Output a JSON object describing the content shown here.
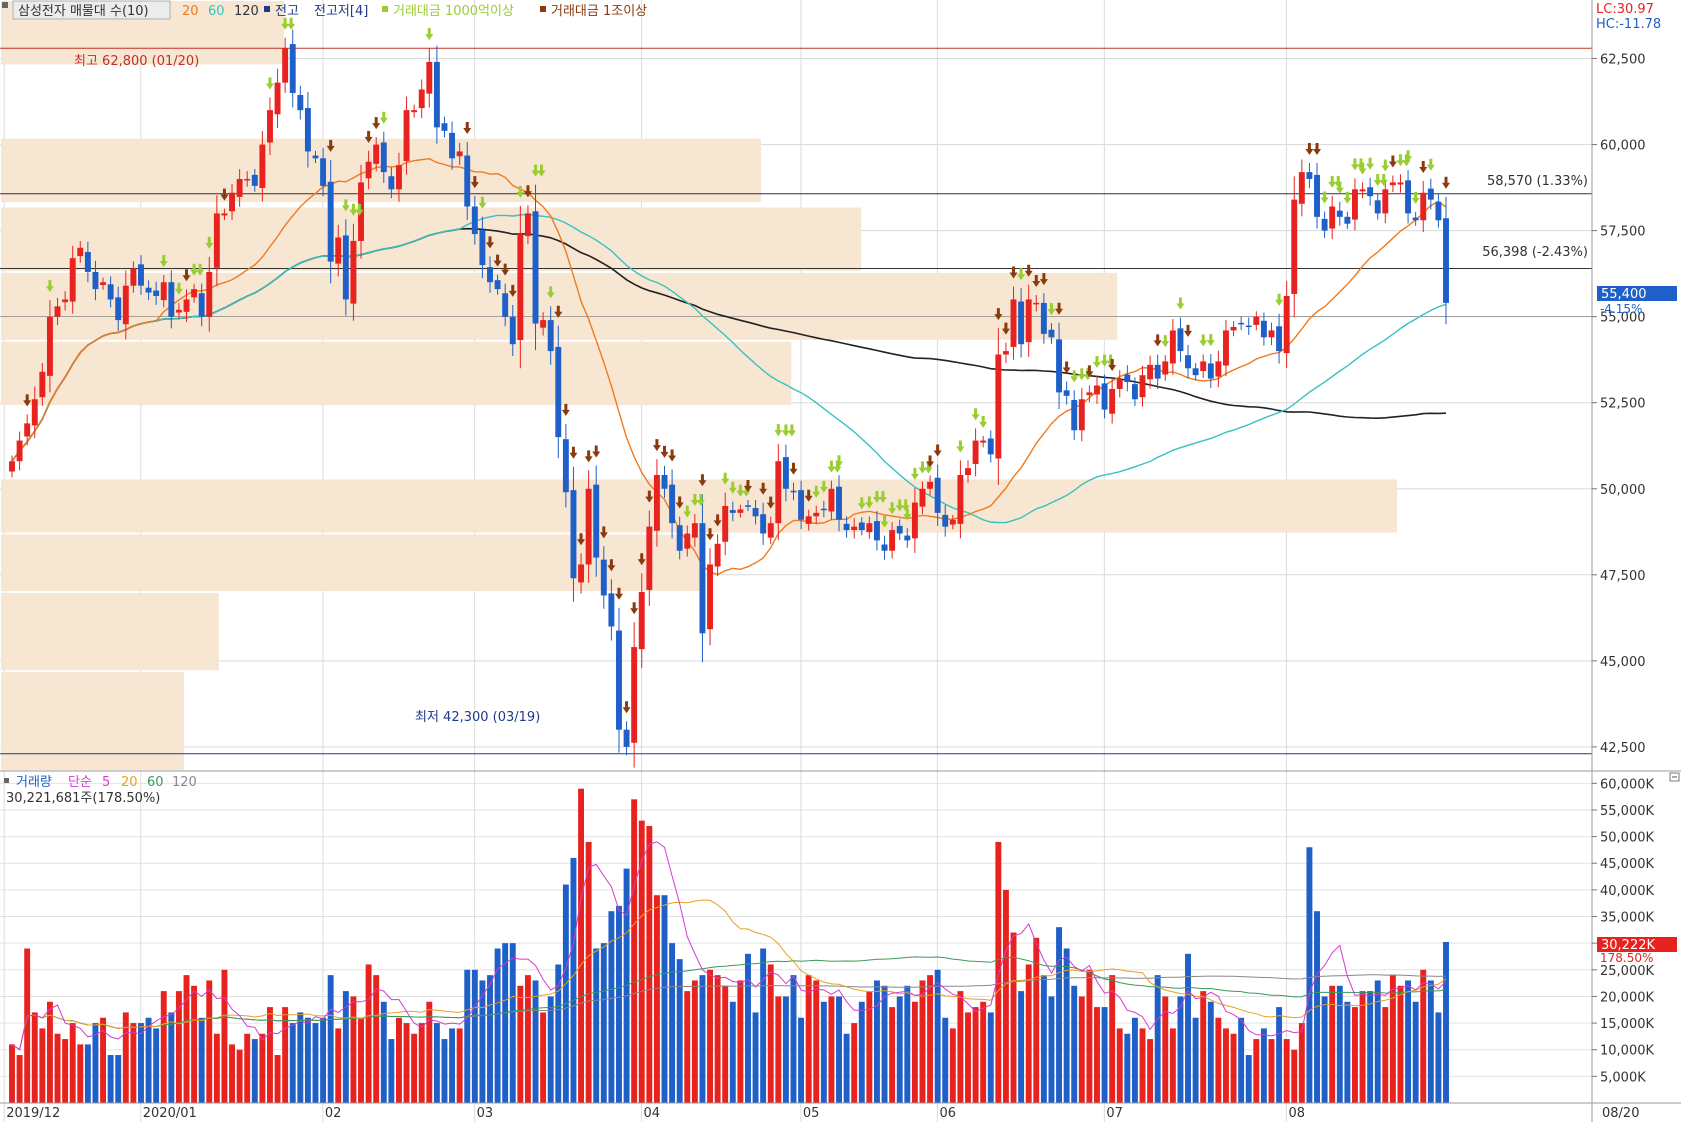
{
  "header": {
    "title": "삼성전자 매물대 수(10)",
    "ma_periods": [
      "20",
      "60",
      "120"
    ],
    "prev_high": "전고",
    "prev_high_low": "전고저[4]",
    "value_1000": "거래대금 1000억이상",
    "value_1t": "거래대금 1조이상",
    "lc": "LC:30.97",
    "hc": "HC:-11.78"
  },
  "volume_header": {
    "title": "거래량",
    "simple": "단순",
    "periods": [
      "5",
      "20",
      "60",
      "120"
    ],
    "current": "30,221,681주(178.50%)"
  },
  "annotations": {
    "high": "최고 62,800 (01/20)",
    "low": "최저 42,300 (03/19)",
    "level1": "58,570 (1.33%)",
    "level2": "56,398 (-2.43%)",
    "last_price": "55,400",
    "last_change": "-4.15%",
    "last_volume": "30,222K",
    "last_volume_pct": "178.50%"
  },
  "x_axis": {
    "labels": [
      "2019/12",
      "2020/01",
      "02",
      "03",
      "04",
      "05",
      "06",
      "07",
      "08"
    ],
    "right_label": "08/20"
  },
  "colors": {
    "up": "#e8231f",
    "down": "#1f5fc8",
    "ma20": "#f07a1e",
    "ma60": "#38c2c0",
    "ma120": "#222222",
    "profile": "#f7e6d2",
    "arrow_brown": "#8b3a0e",
    "arrow_green": "#9acd32",
    "vol_ma5": "#d43ad0",
    "vol_ma20": "#e8a020",
    "vol_ma60": "#3a9a5a",
    "vol_ma120": "#888888"
  },
  "chart_data": {
    "type": "candlestick",
    "price_ticks": [
      "62,500",
      "60,000",
      "57,500",
      "55,000",
      "52,500",
      "50,000",
      "47,500",
      "45,000",
      "42,500"
    ],
    "volume_ticks": [
      "60,000K",
      "55,000K",
      "50,000K",
      "45,000K",
      "40,000K",
      "35,000K",
      "30,000K",
      "25,000K",
      "20,000K",
      "15,000K",
      "10,000K",
      "5,000K"
    ],
    "ylim_price": [
      41800,
      64200
    ],
    "ylim_volume": [
      0,
      61000
    ],
    "hlines": [
      62800,
      58570,
      56398,
      42300
    ],
    "closes": [
      50800,
      51400,
      51900,
      52600,
      53400,
      55000,
      55300,
      55500,
      56700,
      57000,
      56300,
      55800,
      56000,
      55500,
      54900,
      55900,
      56400,
      55900,
      55700,
      55600,
      56000,
      55000,
      55200,
      55500,
      55800,
      55000,
      56300,
      58000,
      58000,
      58600,
      59000,
      59000,
      58800,
      60000,
      61000,
      61800,
      62800,
      61500,
      61000,
      59800,
      59600,
      58800,
      56600,
      57300,
      55500,
      57200,
      58900,
      59500,
      60000,
      59200,
      58700,
      59400,
      61000,
      61000,
      61600,
      62400,
      60500,
      60400,
      59600,
      59800,
      58200,
      57400,
      56500,
      56000,
      55800,
      55000,
      54200,
      57400,
      58000,
      54800,
      54900,
      54000,
      51500,
      49900,
      47400,
      47800,
      50000,
      48000,
      46900,
      46000,
      43000,
      42500,
      45400,
      47000,
      48900,
      50400,
      50000,
      49000,
      48200,
      48700,
      49000,
      45800,
      47800,
      48400,
      49500,
      49300,
      49400,
      49500,
      49200,
      48700,
      49000,
      50800,
      50000,
      49900,
      49100,
      49200,
      49300,
      49400,
      50000,
      49100,
      48800,
      48900,
      48800,
      49000,
      48500,
      48200,
      48800,
      48700,
      48500,
      49600,
      50000,
      50200,
      49300,
      48900,
      49100,
      50400,
      50600,
      51400,
      51400,
      51000,
      53900,
      54000,
      55500,
      54200,
      55500,
      55400,
      54500,
      54400,
      52800,
      52700,
      51700,
      52600,
      52800,
      53000,
      52300,
      52900,
      53200,
      53100,
      52600,
      53300,
      53600,
      53200,
      53700,
      54600,
      54000,
      53500,
      53300,
      53700,
      53200,
      53700,
      54600,
      54700,
      54800,
      54700,
      55000,
      54400,
      54600,
      54000,
      55600,
      58400,
      59200,
      59000,
      57900,
      57500,
      58200,
      57900,
      57700,
      58700,
      58700,
      58500,
      58000,
      58700,
      58900,
      58900,
      58000,
      57800,
      58600,
      58400,
      57800,
      55400
    ],
    "volumes": [
      11000,
      9000,
      29000,
      17000,
      14000,
      19000,
      13000,
      12000,
      15000,
      11000,
      11000,
      15000,
      16000,
      9000,
      9000,
      17000,
      15000,
      15000,
      16000,
      14000,
      21000,
      17000,
      21000,
      24000,
      22000,
      16000,
      23000,
      13000,
      25000,
      11000,
      10000,
      13000,
      12000,
      13000,
      18000,
      9000,
      18000,
      15000,
      17000,
      16000,
      15000,
      16000,
      24000,
      14000,
      21000,
      20000,
      16000,
      26000,
      24000,
      19000,
      12000,
      16000,
      15000,
      13000,
      15000,
      19000,
      15000,
      12000,
      14000,
      14000,
      25000,
      25000,
      23000,
      24000,
      29000,
      30000,
      30000,
      22000,
      24000,
      23000,
      17000,
      20000,
      26000,
      41000,
      46000,
      59000,
      49000,
      29000,
      30000,
      36000,
      37000,
      44000,
      57000,
      53000,
      52000,
      39000,
      39000,
      30000,
      27000,
      21000,
      23000,
      24000,
      25000,
      24000,
      22000,
      19000,
      23000,
      28000,
      17000,
      29000,
      26000,
      20000,
      20000,
      24000,
      16000,
      24000,
      23000,
      19000,
      20000,
      20000,
      13000,
      15000,
      19000,
      21000,
      23000,
      22000,
      18000,
      20000,
      22000,
      19000,
      23000,
      24000,
      25000,
      16000,
      14000,
      21000,
      17000,
      18000,
      19000,
      17000,
      49000,
      40000,
      32000,
      21000,
      26000,
      31000,
      24000,
      20000,
      33000,
      29000,
      22000,
      20000,
      25000,
      18000,
      18000,
      24000,
      14000,
      13000,
      16000,
      14000,
      12000,
      24000,
      20000,
      14000,
      20000,
      28000,
      16000,
      21000,
      19000,
      16000,
      14000,
      13000,
      16000,
      9000,
      12000,
      14000,
      12000,
      18000,
      12000,
      10000,
      15000,
      48000,
      36000,
      20000,
      22000,
      22000,
      19000,
      18000,
      21000,
      21000,
      23000,
      18000,
      24000,
      22000,
      23000,
      19000,
      25000,
      23000,
      17000,
      30222
    ],
    "volume_profile": [
      {
        "low": 41800,
        "high": 44700
      },
      {
        "low": 44700,
        "high": 47000
      },
      {
        "low": 47000,
        "high": 48700
      },
      {
        "low": 48700,
        "high": 50300
      },
      {
        "low": 52400,
        "high": 54300
      },
      {
        "low": 54300,
        "high": 56300
      },
      {
        "low": 56300,
        "high": 58200
      },
      {
        "low": 58300,
        "high": 60200
      },
      {
        "low": 62300,
        "high": 64200
      }
    ],
    "volume_profile_rel": [
      0.115,
      0.137,
      0.442,
      0.878,
      0.497,
      0.702,
      0.541,
      0.478,
      0.178
    ]
  }
}
